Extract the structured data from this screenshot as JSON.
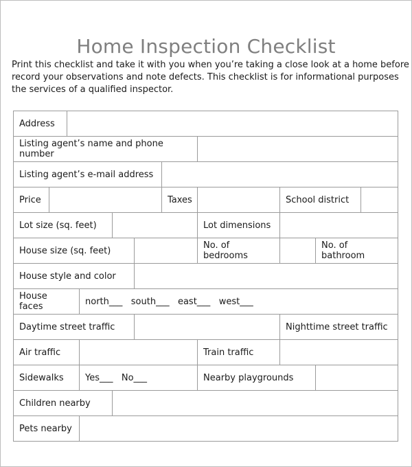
{
  "document": {
    "title": "Home Inspection Checklist",
    "intro_lines": [
      "Print this checklist and take it with you when you’re taking a close look at a home before",
      "record your observations and note defects. This checklist is for informational purposes",
      "the services of a qualified inspector."
    ]
  },
  "table": {
    "rows": [
      [
        "Address",
        ""
      ],
      [
        "Listing agent’s name and phone number",
        ""
      ],
      [
        "Listing agent’s e-mail address",
        ""
      ],
      [
        "Price",
        "",
        "Taxes",
        "",
        "School district",
        ""
      ],
      [
        "Lot size (sq. feet)",
        "",
        "Lot dimensions",
        ""
      ],
      [
        "House size (sq. feet)",
        "",
        "No. of bedrooms",
        "",
        "No. of bathroom"
      ],
      [
        "House style and color",
        ""
      ],
      [
        "House faces",
        "north___   south___   east___   west___"
      ],
      [
        "Daytime street traffic",
        "",
        "Nighttime street traffic"
      ],
      [
        "Air traffic",
        "",
        "Train traffic",
        ""
      ],
      [
        "Sidewalks",
        "Yes___   No___",
        "Nearby playgrounds",
        ""
      ],
      [
        "Children nearby",
        ""
      ],
      [
        "Pets nearby",
        ""
      ]
    ]
  }
}
